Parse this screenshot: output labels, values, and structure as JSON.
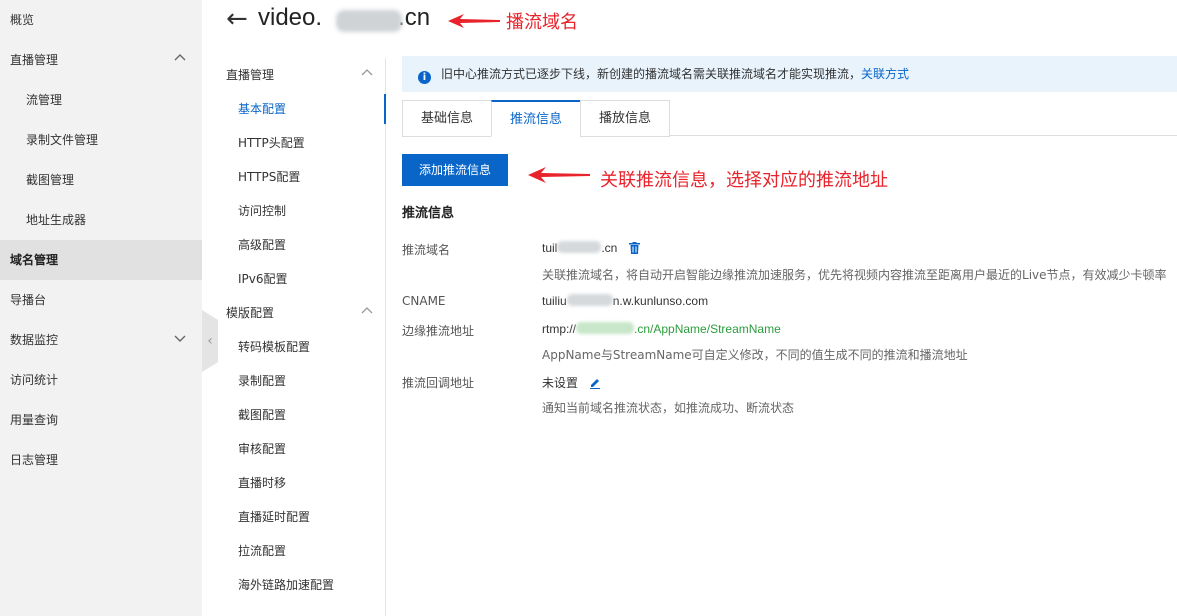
{
  "sidebar": {
    "items": [
      {
        "label": "概览"
      },
      {
        "label": "直播管理"
      },
      {
        "label": "流管理"
      },
      {
        "label": "录制文件管理"
      },
      {
        "label": "截图管理"
      },
      {
        "label": "地址生成器"
      },
      {
        "label": "域名管理"
      },
      {
        "label": "导播台"
      },
      {
        "label": "数据监控"
      },
      {
        "label": "访问统计"
      },
      {
        "label": "用量查询"
      },
      {
        "label": "日志管理"
      }
    ]
  },
  "header": {
    "back_icon": "←",
    "title_prefix": "video.",
    "title_suffix": ".cn",
    "annotation": "播流域名"
  },
  "nav2": {
    "group1": "直播管理",
    "group1_items": [
      "基本配置",
      "HTTP头配置",
      "HTTPS配置",
      "访问控制",
      "高级配置",
      "IPv6配置"
    ],
    "group2": "模版配置",
    "group2_items": [
      "转码模板配置",
      "录制配置",
      "截图配置",
      "审核配置",
      "直播时移",
      "直播延时配置",
      "拉流配置",
      "海外链路加速配置"
    ]
  },
  "notice": {
    "text": "旧中心推流方式已逐步下线，新创建的播流域名需关联推流域名才能实现推流，",
    "link": "关联方式"
  },
  "tabs": [
    "基础信息",
    "推流信息",
    "播放信息"
  ],
  "add_button": "添加推流信息",
  "add_annotation": "关联推流信息，选择对应的推流地址",
  "section_title": "推流信息",
  "fields": {
    "push_domain_label": "推流域名",
    "push_domain_prefix": "tuil",
    "push_domain_suffix": ".cn",
    "push_domain_hint": "关联推流域名，将自动开启智能边缘推流加速服务，优先将视频内容推流至距离用户最近的Live节点，有效减少卡顿率",
    "cname_label": "CNAME",
    "cname_prefix": "tuiliu",
    "cname_suffix": "n.w.kunlunso.com",
    "edge_label": "边缘推流地址",
    "edge_prefix": "rtmp://",
    "edge_suffix": ".cn/",
    "edge_app": "AppName",
    "edge_sep": "/",
    "edge_stream": "StreamName",
    "edge_hint": "AppName与StreamName可自定义修改，不同的值生成不同的推流和播流地址",
    "callback_label": "推流回调地址",
    "callback_value": "未设置",
    "callback_hint": "通知当前域名推流状态，如推流成功、断流状态"
  },
  "colors": {
    "accent": "#0a65c9",
    "annotation": "#e8232b",
    "green": "#2a9d3c"
  }
}
